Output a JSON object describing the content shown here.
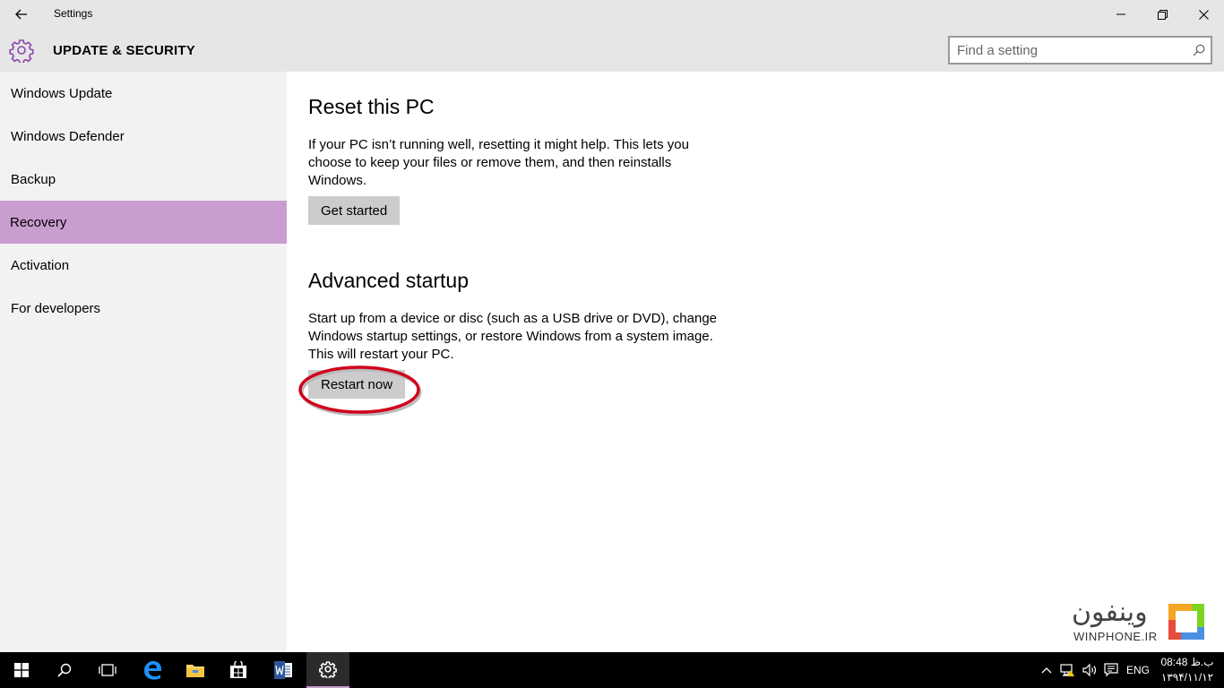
{
  "window": {
    "app_title": "Settings",
    "header_title": "UPDATE & SECURITY",
    "accent_color": "#c99dcf"
  },
  "search": {
    "placeholder": "Find a setting"
  },
  "sidebar": {
    "items": [
      {
        "label": "Windows Update"
      },
      {
        "label": "Windows Defender"
      },
      {
        "label": "Backup"
      },
      {
        "label": "Recovery",
        "selected": true
      },
      {
        "label": "Activation"
      },
      {
        "label": "For developers"
      }
    ]
  },
  "main": {
    "reset": {
      "title": "Reset this PC",
      "description": "If your PC isn’t running well, resetting it might help. This lets you choose to keep your files or remove them, and then reinstalls Windows.",
      "button": "Get started"
    },
    "advanced": {
      "title": "Advanced startup",
      "description": "Start up from a device or disc (such as a USB drive or DVD), change Windows startup settings, or restore Windows from a system image. This will restart your PC.",
      "button": "Restart now"
    }
  },
  "watermark": {
    "text": "WINPHONE.IR",
    "arabic": "وینفون"
  },
  "taskbar": {
    "language": "ENG",
    "time": "08:48 ب.ظ",
    "date": "۱۳۹۴/۱۱/۱۲"
  }
}
